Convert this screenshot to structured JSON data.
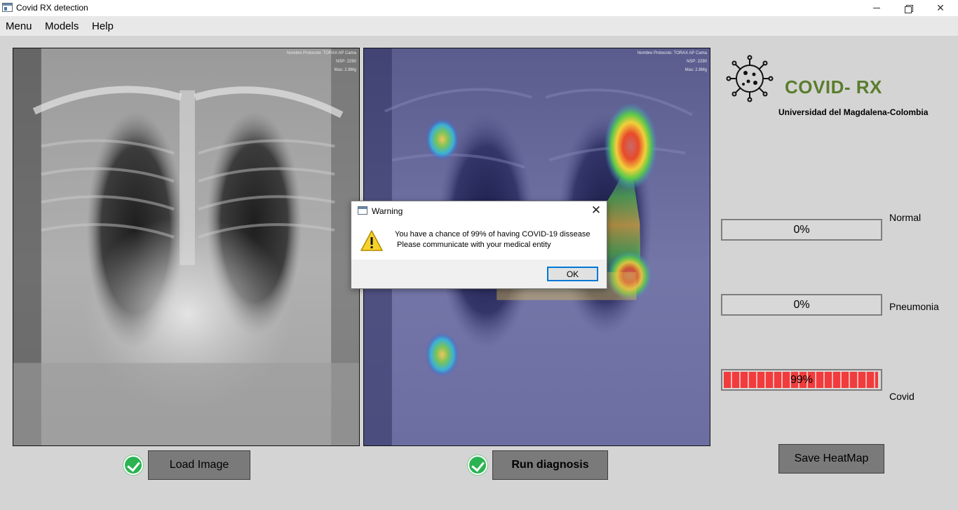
{
  "window": {
    "title": "Covid RX detection",
    "minimize_icon": "minimize-icon",
    "maximize_icon": "restore-icon",
    "close_glyph": "✕"
  },
  "menu": {
    "items": [
      "Menu",
      "Models",
      "Help"
    ]
  },
  "images": {
    "xray_watermark_lines": [
      "Nombre Protocolo: TORAX AP Cama",
      "NSP: 2290",
      "Mas: 2.8Mg"
    ],
    "heatmap_watermark_lines": [
      "Nombre Protocolo: TORAX AP Cama",
      "NSP: 2290",
      "Mas: 2.8Mg"
    ]
  },
  "buttons": {
    "load_image": "Load Image",
    "run_diagnosis": "Run diagnosis",
    "save_heatmap": "Save HeatMap"
  },
  "brand": {
    "title": "COVID- RX",
    "subtitle": "Universidad del Magdalena-Colombia",
    "logo_icon": "virus-icon"
  },
  "results": [
    {
      "label": "Normal",
      "percent_text": "0%",
      "value": 0
    },
    {
      "label": "Pneumonia",
      "percent_text": "0%",
      "value": 0
    },
    {
      "label": "Covid",
      "percent_text": "99%",
      "value": 99
    }
  ],
  "dialog": {
    "title": "Warning",
    "line1": "You have a chance of 99% of having COVID-19 dissease",
    "line2": " Please communicate with your medical entity",
    "ok": "OK",
    "close_glyph": "✕",
    "icon": "warning-icon"
  },
  "colors": {
    "brand_green": "#5a7d2c",
    "progress_red": "#f03c3c",
    "check_green": "#2bb352",
    "dialog_focus": "#0078d7"
  }
}
